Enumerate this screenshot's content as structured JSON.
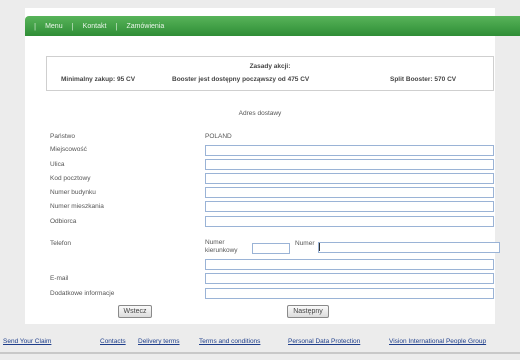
{
  "nav": {
    "items": [
      "Menu",
      "Kontakt",
      "Zamówienia"
    ]
  },
  "rules": {
    "title": "Zasady akcji:",
    "min_purchase": "Minimalny zakup: 95 CV",
    "booster": "Booster jest dostępny począwszy od 475 CV",
    "split_booster": "Split Booster: 570 CV"
  },
  "form": {
    "section_title": "Adres dostawy",
    "labels": {
      "country": "Państwo",
      "city": "Miejscowość",
      "street": "Ulica",
      "postal_code": "Kod pocztowy",
      "building_number": "Numer budynku",
      "apartment_number": "Numer mieszkania",
      "recipient": "Odbiorca",
      "phone": "Telefon",
      "area_code": "Numer kierunkowy",
      "number": "Numer",
      "email": "E-mail",
      "additional_info": "Dodatkowe informacje"
    },
    "country_value": "POLAND",
    "buttons": {
      "back": "Wstecz",
      "next": "Następny"
    }
  },
  "footer": {
    "links": [
      "Send Your Claim",
      "Contacts",
      "Delivery terms",
      "Terms and conditions",
      "Personal Data Protection",
      "Vision International People Group"
    ]
  }
}
